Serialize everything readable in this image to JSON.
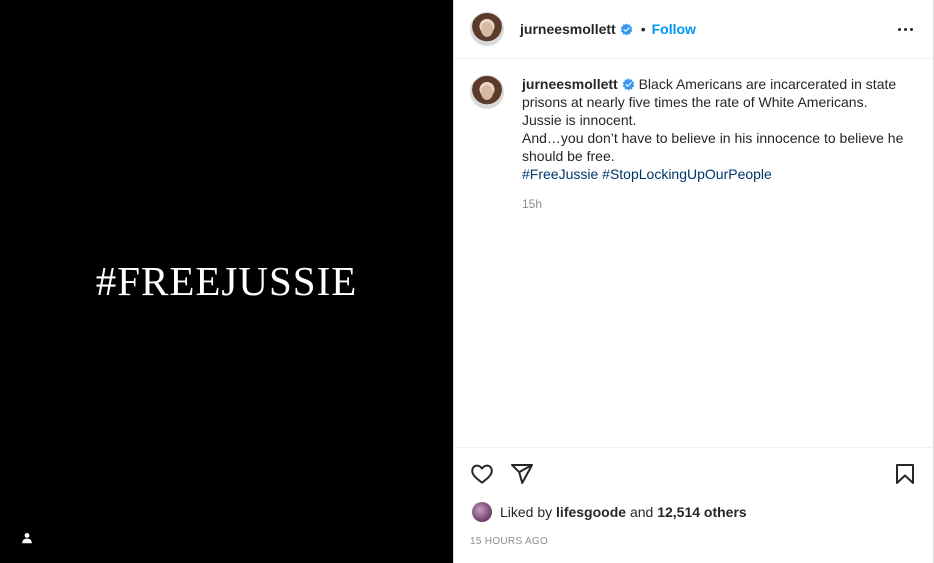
{
  "media": {
    "overlay_text": "#FREEJUSSIE",
    "background_color": "#000000",
    "tag_icon": "user-tag-icon"
  },
  "header": {
    "username": "jurneesmollett",
    "separator": "•",
    "follow_label": "Follow",
    "verified_icon": "verified-badge-icon",
    "more_icon": "more-options-icon"
  },
  "caption": {
    "username": "jurneesmollett",
    "lines": [
      "Black Americans are incarcerated in state prisons at nearly five times the rate of White Americans.",
      "Jussie is innocent.",
      "And…you don’t have to believe in his innocence to believe he should be free."
    ],
    "hashtags": [
      "#FreeJussie",
      "#StopLockingUpOurPeople"
    ],
    "time": "15h"
  },
  "actions": {
    "like_icon": "heart-icon",
    "share_icon": "paper-plane-icon",
    "save_icon": "bookmark-icon"
  },
  "likes": {
    "prefix": "Liked by",
    "user": "lifesgoode",
    "conjunction": "and",
    "others": "12,514 others"
  },
  "posted_ago": "15 HOURS AGO",
  "colors": {
    "accent": "#0095f6",
    "hashtag": "#00376b",
    "verified": "#3897f0",
    "muted": "#8e8e8e"
  }
}
